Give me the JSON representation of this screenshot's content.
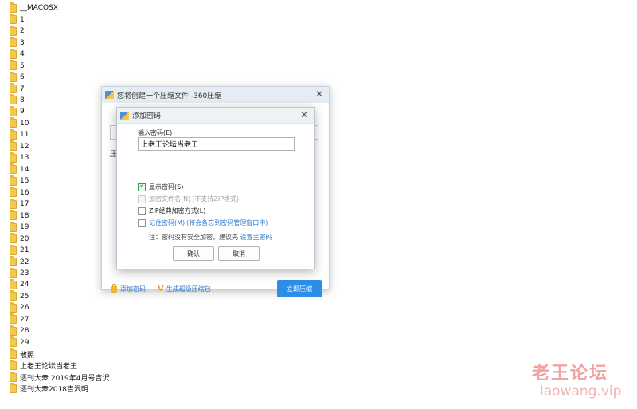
{
  "folders": [
    "__MACOSX",
    "1",
    "2",
    "3",
    "4",
    "5",
    "6",
    "7",
    "8",
    "9",
    "10",
    "11",
    "12",
    "13",
    "14",
    "15",
    "16",
    "17",
    "18",
    "19",
    "20",
    "21",
    "22",
    "23",
    "24",
    "25",
    "26",
    "27",
    "28",
    "29",
    "散照",
    "上老王论坛当老王",
    "逐刊大衆 2019年4月号吉沢",
    "逐刊大衆2018吉沢明"
  ],
  "main_dialog": {
    "title": "您将创建一个压缩文件 -360压缩",
    "ghost_label": "压",
    "add_password_link": "添加密码",
    "super_package_link": "生成超级压缩包",
    "compress_button": "立即压缩"
  },
  "password_dialog": {
    "title": "添加密码",
    "input_label": "输入密码(E)",
    "password_value": "上老王论坛当老王",
    "show_password": {
      "label": "显示密码(S)",
      "checked": true
    },
    "encrypt_filenames": {
      "label": "加密文件名(N)",
      "hint": "(不支持ZIP格式)",
      "checked": false,
      "disabled": true
    },
    "zip_classic": {
      "label": "ZIP经典加密方式(L)",
      "checked": false
    },
    "remember_password": {
      "label": "记住密码(M)",
      "hint": "(将会备忘到密码管理窗口中)",
      "checked": false
    },
    "note_text": "注：密码没有安全加密，建议先",
    "note_link": "设置主密码",
    "ok_button": "确认",
    "cancel_button": "取消"
  },
  "watermark": {
    "cn": "老王论坛",
    "en": "laowang.vip"
  },
  "colors": {
    "accent": "#2d8ee8",
    "folder": "#f2c94c",
    "watermark": "#f2a3a3"
  }
}
